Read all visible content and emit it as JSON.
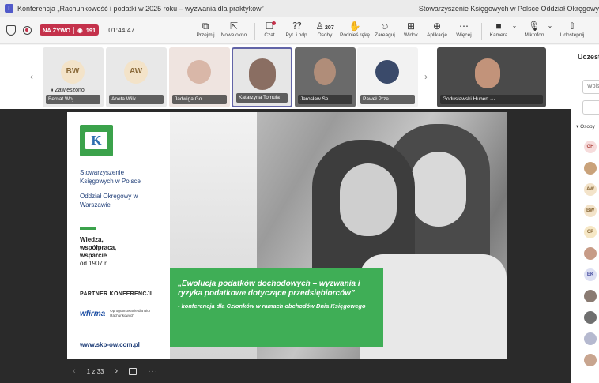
{
  "window": {
    "title": "Konferencja „Rachunkowość i podatki w 2025 roku – wyzwania dla praktyków”",
    "organization": "Stowarzyszenie Księgowych w Polsce Oddział Okręgowy",
    "app_icon": "T"
  },
  "toolbar": {
    "live_label": "NA ŻYWO",
    "viewers": "191",
    "elapsed": "01:44:47",
    "buttons": {
      "przejmij": "Przejmij",
      "nowe_okno": "Nowe okno",
      "czat": "Czat",
      "pytania": "Pyt. i odp.",
      "osoby": "Osoby",
      "osoby_count": "207",
      "podnies": "Podnieś rękę",
      "zareaguj": "Zareaguj",
      "widok": "Widok",
      "aplikacje": "Aplikacje",
      "wiecej": "Więcej",
      "kamera": "Kamera",
      "mikrofon": "Mikrofon",
      "udostepnij": "Udostępnij"
    }
  },
  "participants": {
    "paused_label": "Zawieszono",
    "tiles": [
      {
        "initials": "BW",
        "name": "Bernat Woj...",
        "bg": "#f3e3c9",
        "fg": "#8a6a3a"
      },
      {
        "initials": "AW",
        "name": "Aneta Wilk...",
        "bg": "#f3e3c9",
        "fg": "#8a6a3a"
      },
      {
        "initials": "",
        "name": "Jadwiga Go...",
        "bg": "#e9d4cf",
        "fg": "#000"
      },
      {
        "initials": "",
        "name": "Katarzyna Tomula",
        "bg": "#d9d9d9",
        "fg": "#000"
      },
      {
        "initials": "",
        "name": "Jarosław Se...",
        "bg": "#6a6a6a",
        "fg": "#000"
      },
      {
        "initials": "",
        "name": "Paweł Prze...",
        "bg": "#f0f0f0",
        "fg": "#000"
      },
      {
        "initials": "",
        "name": "Godusławski Hubert",
        "bg": "#4a4a4a",
        "fg": "#000"
      }
    ]
  },
  "side_panel": {
    "header": "Uczestnicy",
    "search_placeholder": "Wpisz",
    "section": "Osoby",
    "avatars": [
      {
        "initials": "GH",
        "bg": "#f6dcdc",
        "fg": "#b0463f"
      },
      {
        "initials": "",
        "bg": "#c9a27a",
        "fg": "#000"
      },
      {
        "initials": "AW",
        "bg": "#f3e3c9",
        "fg": "#8a6a3a"
      },
      {
        "initials": "BW",
        "bg": "#f3e3c9",
        "fg": "#8a6a3a"
      },
      {
        "initials": "CP",
        "bg": "#f6e7c5",
        "fg": "#8a6a3a"
      },
      {
        "initials": "",
        "bg": "#c79b86",
        "fg": "#000"
      },
      {
        "initials": "EK",
        "bg": "#dde0f3",
        "fg": "#4b52a3"
      },
      {
        "initials": "",
        "bg": "#8a7b72",
        "fg": "#000"
      },
      {
        "initials": "",
        "bg": "#6f6f6f",
        "fg": "#000"
      },
      {
        "initials": "",
        "bg": "#b5b9cf",
        "fg": "#000"
      },
      {
        "initials": "",
        "bg": "#c8a58f",
        "fg": "#000"
      }
    ]
  },
  "slide": {
    "org_name": "Stowarzyszenie Księgowych w Polsce",
    "branch": "Oddział Okręgowy w Warszawie",
    "motto_1": "Wiedza,",
    "motto_2": "współpraca,",
    "motto_3": "wsparcie",
    "since": "od 1907 r.",
    "partner_label": "PARTNER KONFERENCJI",
    "partner_name": "wfirma",
    "partner_sub": "Oprogramowanie dla Biur Rachunkowych",
    "url": "www.skp-ow.com.pl",
    "headline": "„Ewolucja podatków dochodowych – wyzwania i ryzyka podatkowe dotyczące przedsiębiorców”",
    "subline": "- konferencja dla Członków w ramach obchodów Dnia Księgowego",
    "logo_letter": "K"
  },
  "pager": {
    "page_label": "1 z 33"
  },
  "colors": {
    "live_red": "#c4314b",
    "brand_green": "#3fae56",
    "brand_blue": "#1f3e78"
  }
}
